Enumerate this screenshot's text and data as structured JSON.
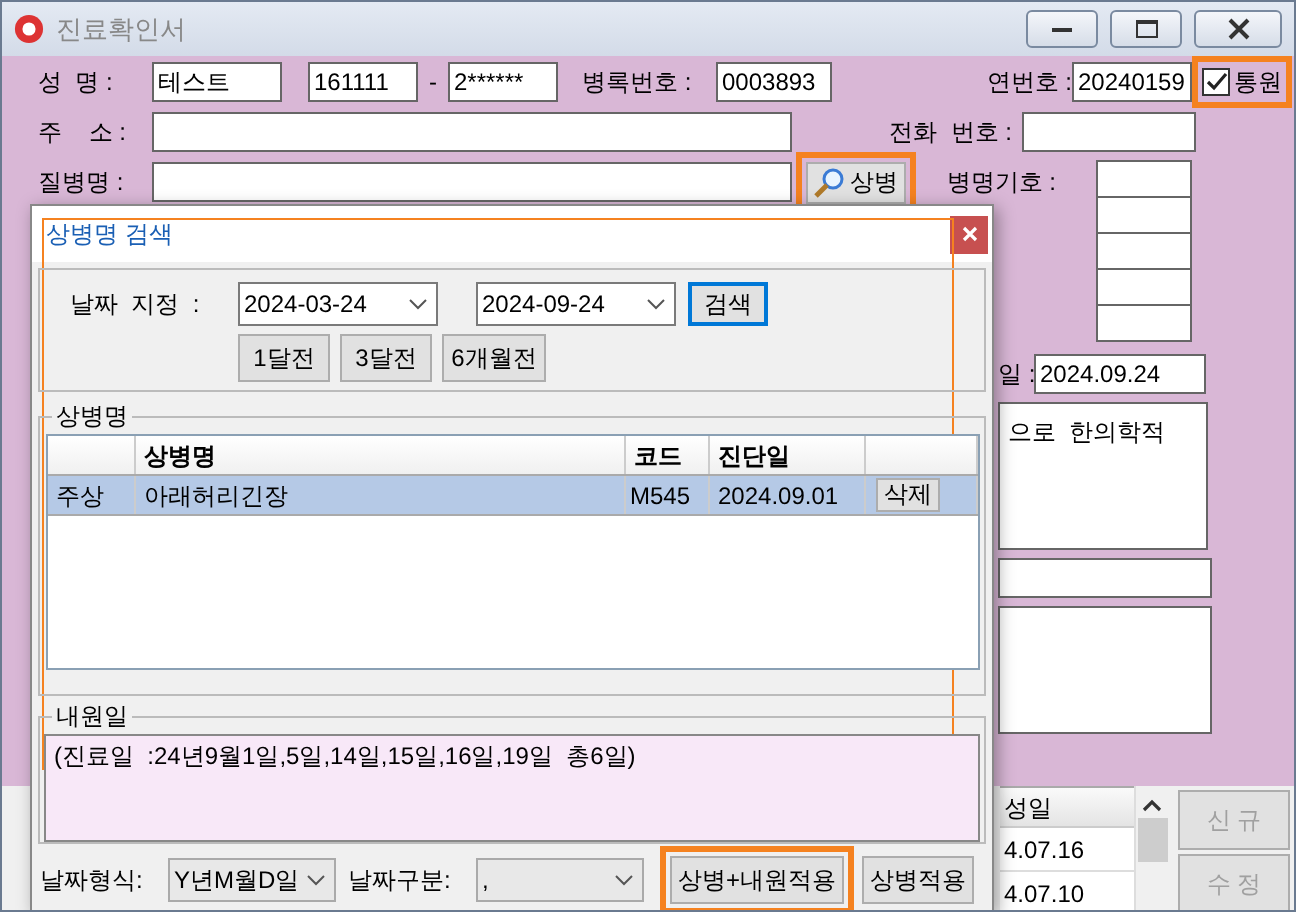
{
  "window": {
    "title": "진료확인서"
  },
  "form": {
    "name_label": "성  명 :",
    "name": "테스트",
    "id_front": "161111",
    "id_dash": "-",
    "id_back": "2******",
    "chart_no_label": "병록번호 :",
    "chart_no": "0003893",
    "serial_label": "연번호 :",
    "serial": "20240159",
    "outpatient": {
      "label": "통원",
      "checked": true,
      "highlighted": true
    },
    "address_label": "주    소 :",
    "phone_label": "전화  번호 :",
    "disease_label": "질병명 :",
    "disease_button": {
      "label": "상병",
      "highlighted": true
    },
    "disease_code_label": "병명기호 :",
    "date_label": "일 :",
    "date": "2024.09.24",
    "opinion": "으로  한의학적"
  },
  "dialog": {
    "title": "상병명 검색",
    "highlighted": true,
    "date_label": "날짜  지정  :",
    "from": "2024-03-24",
    "to": "2024-09-24",
    "search_button": {
      "label": "검색",
      "focused": true
    },
    "quick_buttons": [
      "1달전",
      "3달전",
      "6개월전"
    ],
    "list_label": "상병명",
    "columns": [
      "",
      "상병명",
      "코드",
      "진단일",
      ""
    ],
    "rows": [
      {
        "type": "주상",
        "name": "아래허리긴장",
        "code": "M545",
        "date": "2024.09.01",
        "action": "삭제",
        "selected": true
      }
    ],
    "visit_label": "내원일",
    "visit_text": "(진료일  :24년9월1일,5일,14일,15일,16일,19일  총6일)",
    "format_label": "날짜형식:",
    "format": "Y년M월D일",
    "separator_label": "날짜구분:",
    "separator": ",",
    "apply_both_button": {
      "label": "상병+내원적용",
      "highlighted": true
    },
    "apply_button": {
      "label": "상병적용",
      "highlighted": false
    }
  },
  "history": {
    "column": "성일",
    "rows": [
      "4.07.16",
      "4.07.10"
    ]
  },
  "side_buttons": [
    {
      "label": "신    규",
      "disabled": true
    },
    {
      "label": "수    정",
      "disabled": true
    }
  ]
}
